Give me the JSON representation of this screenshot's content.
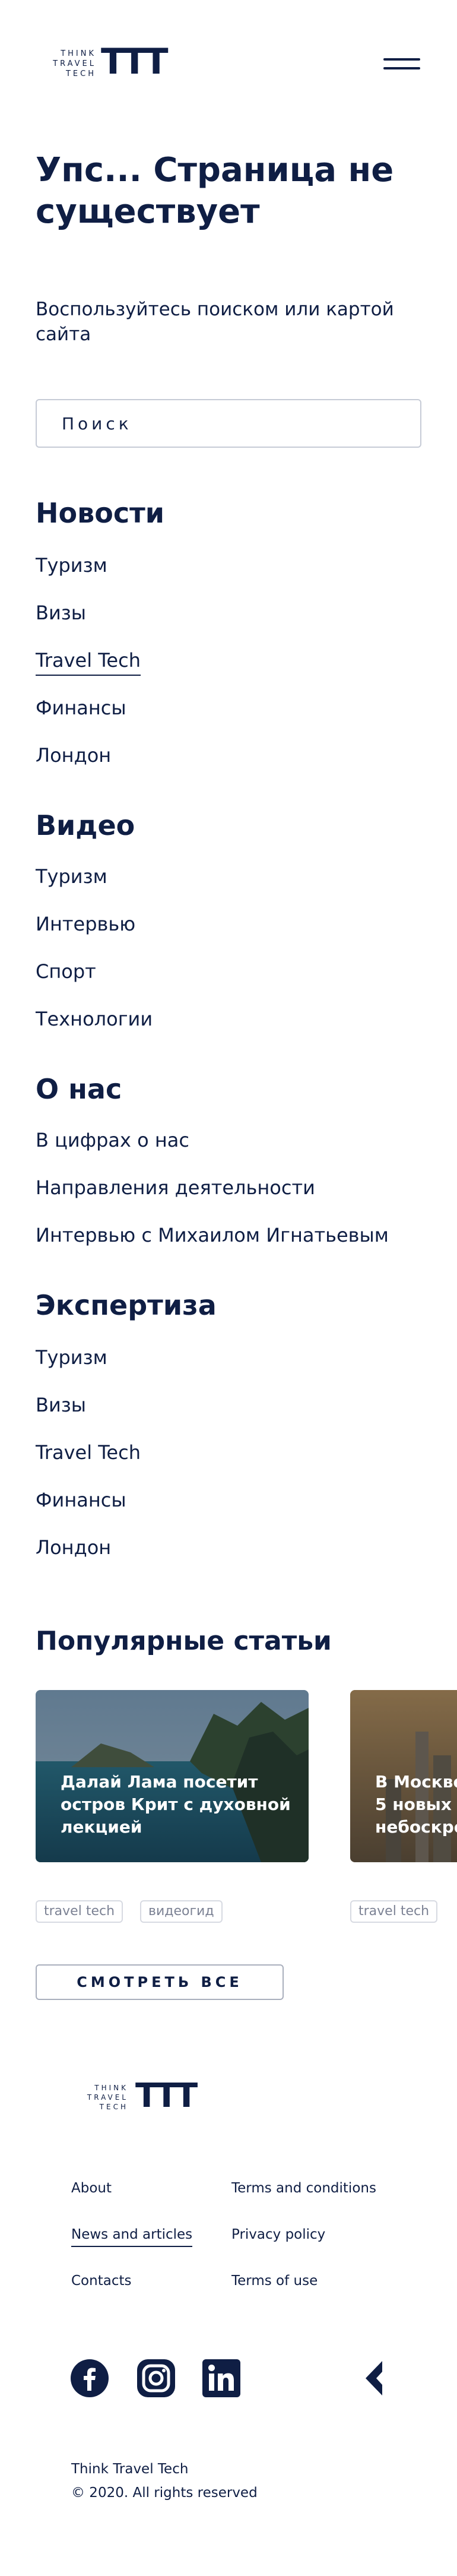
{
  "header": {
    "logo_text_lines": [
      "THINK",
      "TRAVEL",
      "TECH"
    ],
    "logo_mark": "TTT",
    "menu_icon": "hamburger-icon"
  },
  "error": {
    "title_line1": "Упс... Страница не",
    "title_line2": "существует",
    "lead_line1": "Воспользуйтесь поиском или картой",
    "lead_line2": "сайта"
  },
  "search": {
    "placeholder": "Поиск",
    "icon": "search-icon"
  },
  "sections": [
    {
      "title": "Новости",
      "links": [
        "Туризм",
        "Визы",
        "Travel Tech",
        "Финансы",
        "Лондон"
      ]
    },
    {
      "title": "Видео",
      "links": [
        "Туризм",
        "Интервью",
        "Спорт",
        "Технологии"
      ]
    },
    {
      "title": "О нас",
      "links": [
        "В цифрах о нас",
        "Направления деятельности",
        "Интервью с Михаилом Игнатьевым"
      ]
    },
    {
      "title": "Экспертиза",
      "links": [
        "Туризм",
        "Визы",
        "Travel Tech",
        "Финансы",
        "Лондон"
      ]
    }
  ],
  "popular": {
    "title": "Популярные статьи",
    "cards": [
      {
        "title_lines": [
          "Далай Лама посетит",
          "остров Крит с духовной",
          "лекцией"
        ],
        "tags": [
          "travel tech",
          "видеогид"
        ]
      },
      {
        "title_lines": [
          "В Москве",
          "5 новых в",
          "небоскре"
        ],
        "tags": [
          "travel tech"
        ]
      }
    ],
    "button_label": "СМОТРЕТЬ ВСЕ"
  },
  "footer": {
    "logo_text_lines": [
      "THINK",
      "TRAVEL",
      "TECH"
    ],
    "logo_mark": "TTT",
    "links_col1": [
      "About",
      "News and articles",
      "Contacts"
    ],
    "links_col2": [
      "Terms and conditions",
      "Privacy policy",
      "Terms of use"
    ],
    "social_icons": [
      "facebook-icon",
      "instagram-icon",
      "linkedin-icon"
    ],
    "company": "Think Travel Tech",
    "copyright": "© 2020. All rights reserved"
  },
  "colors": {
    "primary": "#0f1e44",
    "border": "#c6cbd6",
    "tag_text": "#7c8294"
  }
}
